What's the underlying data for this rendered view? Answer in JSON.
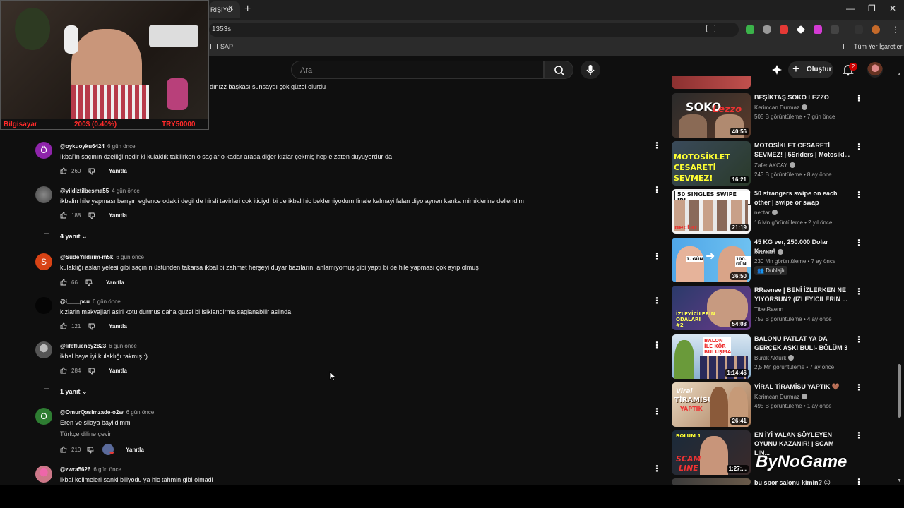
{
  "browser": {
    "tab_title": "RIŞIYO",
    "url_text": "1353s",
    "bookmarks": [
      "SAP"
    ],
    "all_bookmarks": "Tüm Yer İşaretleri"
  },
  "header": {
    "search_placeholder": "Ara",
    "create_label": "Oluştur",
    "notif_count": "2"
  },
  "webcam": {
    "label": "Bilgisayar",
    "pct": "200$ (0.40%)",
    "price": "TRY50000"
  },
  "comments": {
    "partial_text": "dınızz başkası sunsaydı çok güzel olurdu",
    "reply_label": "Yanıtla",
    "items": [
      {
        "author": "@oykuoyku6424",
        "time": "6 gün önce",
        "text": "Ikbal'in saçının özelliği nedir ki kulaklık takilirken o saçlar o kadar arada diğer kızlar çekmiş hep e zaten duyuyordur da",
        "likes": "260",
        "avatar": "Ö",
        "color": "#8e24aa"
      },
      {
        "author": "@yildiztilbesma55",
        "time": "4 gün önce",
        "text": "ikbalin hile yapması barışın eglence odakli degil de hirsli tavirlari cok iticiydi bi de ikbal hic beklemiyodum finale kalmayi falan diyo aynen kanka mimiklerine dellendim",
        "likes": "188",
        "avatar": "",
        "color": "#666"
      },
      {
        "author": "@SudeYıldırım-m5k",
        "time": "6 gün önce",
        "text": "kulaklığı aslan yelesi gibi saçının üstünden takarsa ikbal bi zahmet herşeyi duyar bazılarını anlamıyomuş gibi yaptı bi de hile yapması çok ayıp olmuş",
        "likes": "66",
        "avatar": "S",
        "color": "#d84315"
      },
      {
        "author": "@i____pcu",
        "time": "6 gün önce",
        "text": "kizlarin makyajlari asiri kotu durmus daha guzel bi isiklandirma saglanabilir aslinda",
        "likes": "121",
        "avatar": "",
        "color": "#050505"
      },
      {
        "author": "@lifefluency2823",
        "time": "6 gün önce",
        "text": "ikbal baya iyi kulaklığı takmış :)",
        "likes": "284",
        "avatar": "",
        "color": "#555"
      },
      {
        "author": "@OmurQasimzade-o2w",
        "time": "6 gün önce",
        "text": "Eren ve silaya bayildimm",
        "likes": "210",
        "avatar": "O",
        "color": "#2e7d32"
      },
      {
        "author": "@zwra5626",
        "time": "6 gün önce",
        "text": "ikbal kelimeleri sanki biliyodu ya hic tahmin gibi olmadi",
        "likes": "",
        "avatar": "",
        "color": "#c78"
      }
    ],
    "replies_1": "4 yanıt",
    "replies_2": "1 yanıt",
    "translate": "Türkçe diline çevir"
  },
  "sidebar": {
    "videos": [
      {
        "title": "BEŞİKTAŞ SOKO LEZZO",
        "channel": "Kerimcan Durmaz",
        "meta": "505 B görüntüleme • 7 gün önce",
        "duration": "40:56"
      },
      {
        "title": "MOTOSİKLET CESARETİ SEVMEZ! | 5Sriders | Motosikl...",
        "channel": "Zafer AKCAY",
        "meta": "243 B görüntüleme • 8 ay önce",
        "duration": "16:21"
      },
      {
        "title": "50 strangers swipe on each other | swipe or swap",
        "channel": "nectar",
        "meta": "16 Mn görüntüleme • 2 yıl önce",
        "duration": "21:19"
      },
      {
        "title": "45 KG ver, 250.000 Dolar Kazan!",
        "channel": "MrBeast",
        "meta": "230 Mn görüntüleme • 7 ay önce",
        "duration": "36:50",
        "badge": "Dublajlı"
      },
      {
        "title": "RRaenee | BENİ İZLERKEN NE YİYORSUN? (İZLEYİCİLERİN ...",
        "channel": "TibetRaenn",
        "meta": "752 B görüntüleme • 4 ay önce",
        "duration": "54:08"
      },
      {
        "title": "BALONU PATLAT YA DA GERÇEK AŞKI BUL!- BÖLÜM 3",
        "channel": "Burak Aktürk",
        "meta": "2,5 Mn görüntüleme • 7 ay önce",
        "duration": "1:14:46"
      },
      {
        "title": "VİRAL TİRAMİSU YAPTIK 🤎",
        "channel": "Kerimcan Durmaz",
        "meta": "495 B görüntüleme • 1 ay önce",
        "duration": "26:41"
      },
      {
        "title": "EN İYİ YALAN SÖYLEYEN OYUNU KAZANIR! | SCAM LIN...",
        "channel": "",
        "meta": "",
        "duration": "1:27:..."
      },
      {
        "title": "bu spor salonu kimin? 😐",
        "channel": "",
        "meta": "",
        "duration": ""
      }
    ],
    "thumb_texts": {
      "soko": "SOKO",
      "lezzo": "Lezzo",
      "moto1": "MOTOSİKLET",
      "moto2": "CESARETİ",
      "moto3": "SEVMEZ!",
      "swipe": "50 SINGLES SWIPE IRL",
      "nectar": "nectar",
      "gun1": "1. GÜN",
      "gun2": "100. GÜN",
      "izleyici": "İZLEYİCİLERİN ODALARI #2",
      "balon": "BALON İLE KÖR BULUŞMA",
      "viral1": "Viral",
      "viral2": "TİRAMİSU",
      "viral3": "YAPTIK",
      "bolum": "BÖLÜM 1",
      "scam1": "SCAM",
      "scam2": "LINE"
    }
  },
  "watermark": "ByNoGame"
}
